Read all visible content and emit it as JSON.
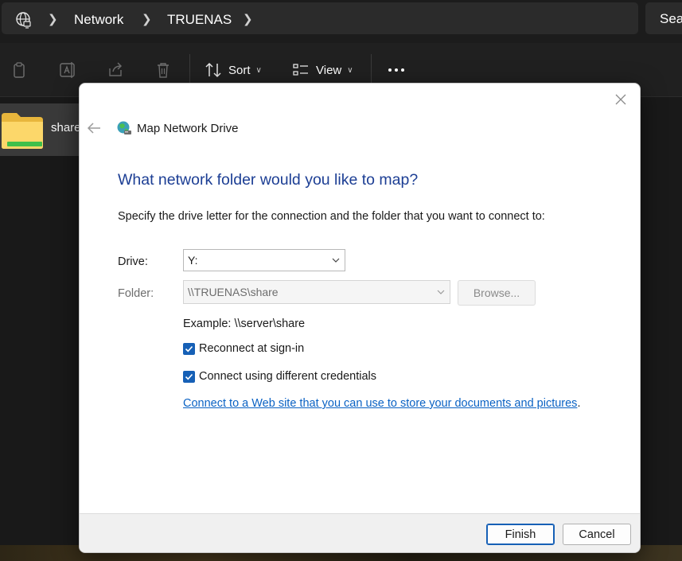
{
  "address_bar": {
    "location_icon": "globe-icon",
    "breadcrumbs": [
      {
        "label": "Network"
      },
      {
        "label": "TRUENAS"
      }
    ],
    "search_placeholder": "Sea"
  },
  "command_bar": {
    "icons": [
      "copy-icon",
      "rename-icon",
      "share-icon",
      "delete-icon",
      "more-icon"
    ],
    "sort_label": "Sort",
    "view_label": "View"
  },
  "files": [
    {
      "name": "share",
      "icon": "folder-icon"
    }
  ],
  "dialog": {
    "title": "Map Network Drive",
    "title_icon": "network-drive-icon",
    "heading": "What network folder would you like to map?",
    "instruction": "Specify the drive letter for the connection and the folder that you want to connect to:",
    "drive_label": "Drive:",
    "drive_value": "Y:",
    "folder_label": "Folder:",
    "folder_value": "\\\\TRUENAS\\share",
    "browse_label": "Browse...",
    "example_text": "Example: \\\\server\\share",
    "reconnect_label": "Reconnect at sign-in",
    "reconnect_checked": true,
    "credentials_label": "Connect using different credentials",
    "credentials_checked": true,
    "link_text": "Connect to a Web site that you can use to store your documents and pictures",
    "link_suffix": ".",
    "finish_label": "Finish",
    "cancel_label": "Cancel"
  },
  "colors": {
    "accent": "#1660b6",
    "heading": "#1c3e94",
    "link": "#0a62c4",
    "explorer_bg": "#1c1c1c"
  }
}
